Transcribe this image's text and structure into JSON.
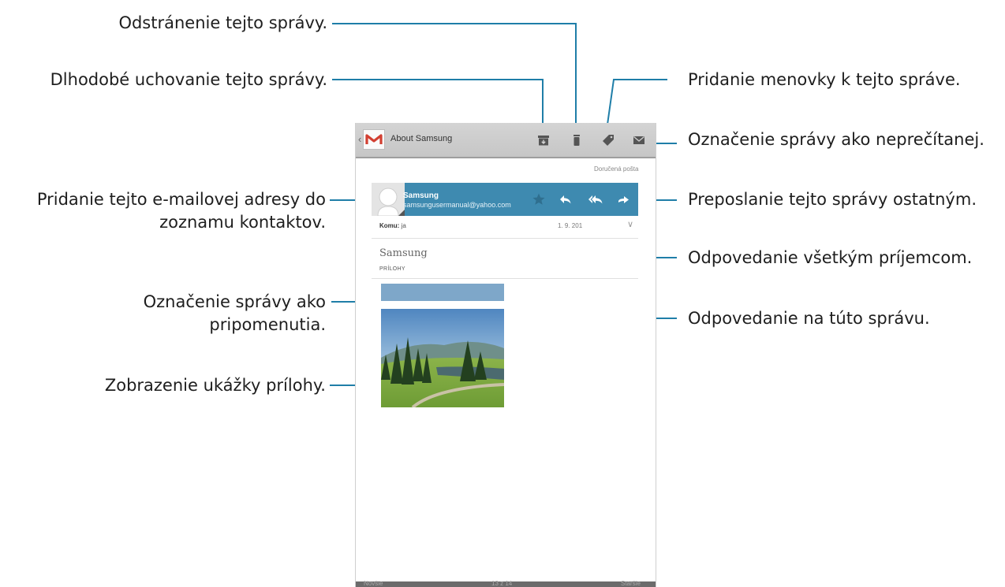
{
  "callouts": {
    "delete": "Odstránenie tejto správy.",
    "archive": "Dlhodobé uchovanie tejto správy.",
    "add_contact_line1": "Pridanie tejto e-mailovej adresy do",
    "add_contact_line2": "zoznamu kontaktov.",
    "star_line1": "Označenie správy ako",
    "star_line2": "pripomenutia.",
    "preview_attachment": "Zobrazenie ukážky prílohy.",
    "label": "Pridanie menovky k tejto správe.",
    "mark_unread": "Označenie správy ako neprečítanej.",
    "forward": "Preposlanie tejto správy ostatným.",
    "reply_all": "Odpovedanie všetkým príjemcom.",
    "reply": "Odpovedanie na túto správu."
  },
  "actionbar": {
    "title": "About Samsung",
    "icons": [
      "archive-icon",
      "trash-icon",
      "label-icon",
      "mail-icon"
    ]
  },
  "message": {
    "folder": "Doručená pošta",
    "sender_name": "Samsung",
    "sender_email": "samsungusermanual@yahoo.com",
    "to_label": "Komu:",
    "to_value": "ja",
    "date": "1. 9. 201",
    "subject": "Samsung",
    "attachments_header": "PRÍLOHY"
  },
  "bottombar": {
    "newer": "Novšie",
    "position": "13 z 14",
    "older": "Staršie"
  },
  "colors": {
    "accent": "#3e8ab0",
    "callout_line": "#1f7ea8",
    "actionbar": "#cfcfcf",
    "attachment_bar": "#7ea7c9"
  }
}
